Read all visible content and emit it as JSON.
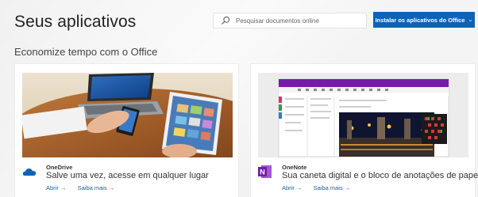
{
  "header": {
    "title": "Seus aplicativos",
    "search": {
      "placeholder": "Pesquisar documentos online",
      "icon": "search-icon"
    },
    "install_button": {
      "label": "Instalar os aplicativos do Office",
      "chevron": "⌄",
      "color": "#0f62b5"
    }
  },
  "section": {
    "title": "Economize tempo com o Office"
  },
  "apps": [
    {
      "name": "OneDrive",
      "description": "Salve uma vez, acesse em qualquer lugar",
      "open_label": "Abrir →",
      "learn_label": "Saiba mais →",
      "icon": "onedrive-cloud-icon",
      "accent": "#0f62b5"
    },
    {
      "name": "OneNote",
      "description": "Sua caneta digital e o bloco de anotações de papel",
      "open_label": "Abrir →",
      "learn_label": "Saiba mais →",
      "icon": "onenote-icon",
      "accent": "#7719aa"
    }
  ]
}
